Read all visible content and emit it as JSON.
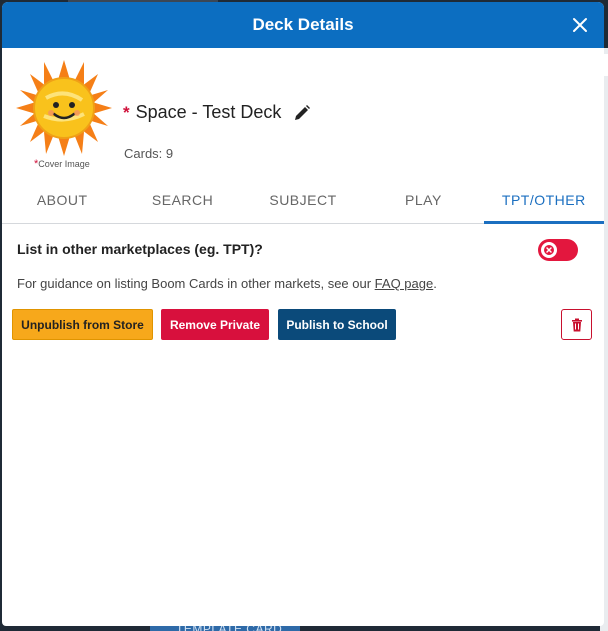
{
  "modal": {
    "title": "Deck Details"
  },
  "deck": {
    "title": "Space - Test Deck",
    "required_marker": "*",
    "cards_count": "Cards: 9",
    "cover_label": "Cover Image",
    "cover_required_marker": "*"
  },
  "tabs": [
    {
      "label": "ABOUT",
      "active": false
    },
    {
      "label": "SEARCH",
      "active": false
    },
    {
      "label": "SUBJECT",
      "active": false
    },
    {
      "label": "PLAY",
      "active": false
    },
    {
      "label": "TPT/OTHER",
      "active": true
    }
  ],
  "tpt": {
    "question": "List in other marketplaces (eg. TPT)?",
    "toggle_on": false,
    "guidance_prefix": "For guidance on listing Boom Cards in other markets, see our ",
    "guidance_link": "FAQ page",
    "guidance_suffix": ".",
    "buttons": {
      "unpublish": "Unpublish from Store",
      "remove_private": "Remove Private",
      "publish_school": "Publish to School"
    }
  },
  "background": {
    "bottom_text": "TEMPLATE CARD"
  },
  "icons": {
    "close": "close-icon",
    "edit": "pencil-icon",
    "trash": "trash-icon",
    "toggle": "x-icon",
    "cover": "sun-icon"
  },
  "colors": {
    "header": "#0c6ec1",
    "active_tab": "#1b6fc0",
    "unpublish": "#f7a81b",
    "remove": "#d8103d",
    "school": "#0b4a7a",
    "toggle_off": "#e3173e"
  }
}
